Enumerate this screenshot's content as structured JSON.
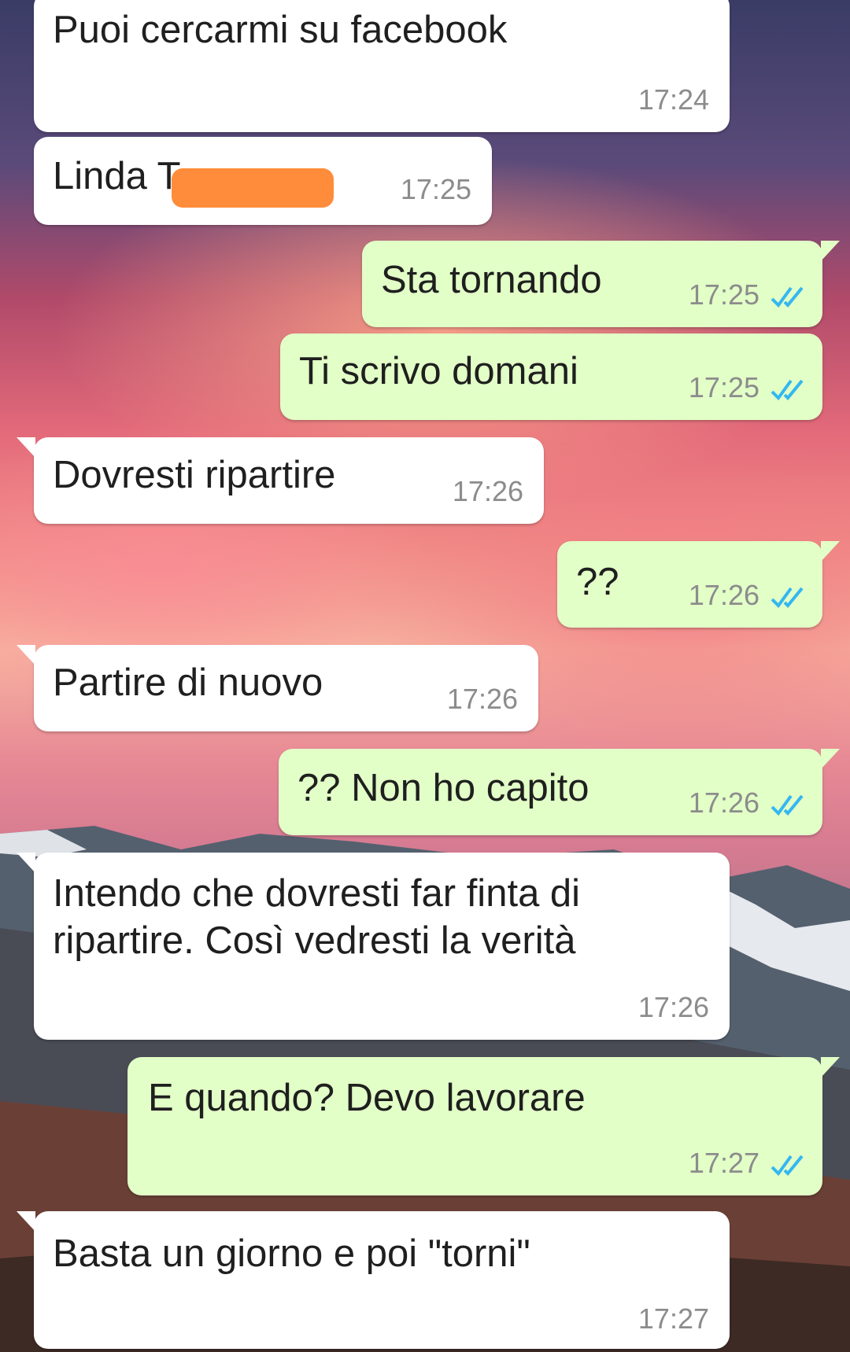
{
  "chat": {
    "messages": [
      {
        "direction": "incoming",
        "text": "Puoi cercarmi su facebook",
        "time": "17:24"
      },
      {
        "direction": "incoming",
        "text": "Linda T",
        "time": "17:25",
        "redacted": true
      },
      {
        "direction": "outgoing",
        "text": "Sta tornando",
        "time": "17:25",
        "status": "read"
      },
      {
        "direction": "outgoing",
        "text": "Ti scrivo domani",
        "time": "17:25",
        "status": "read"
      },
      {
        "direction": "incoming",
        "text": "Dovresti ripartire",
        "time": "17:26"
      },
      {
        "direction": "outgoing",
        "text": "??",
        "time": "17:26",
        "status": "read"
      },
      {
        "direction": "incoming",
        "text": "Partire di nuovo",
        "time": "17:26"
      },
      {
        "direction": "outgoing",
        "text": "?? Non ho capito",
        "time": "17:26",
        "status": "read"
      },
      {
        "direction": "incoming",
        "text": "Intendo che dovresti far finta di\nripartire. Così vedresti la verità",
        "time": "17:26"
      },
      {
        "direction": "outgoing",
        "text": "E quando? Devo lavorare",
        "time": "17:27",
        "status": "read"
      },
      {
        "direction": "incoming",
        "text": "Basta un giorno e poi \"torni\"",
        "time": "17:27"
      }
    ]
  },
  "colors": {
    "incoming_bubble": "#ffffff",
    "outgoing_bubble": "#e2ffc7",
    "read_ticks": "#34b7f1",
    "redaction": "#ff8c3a"
  },
  "icons": {
    "read_status": "double-check-icon"
  }
}
